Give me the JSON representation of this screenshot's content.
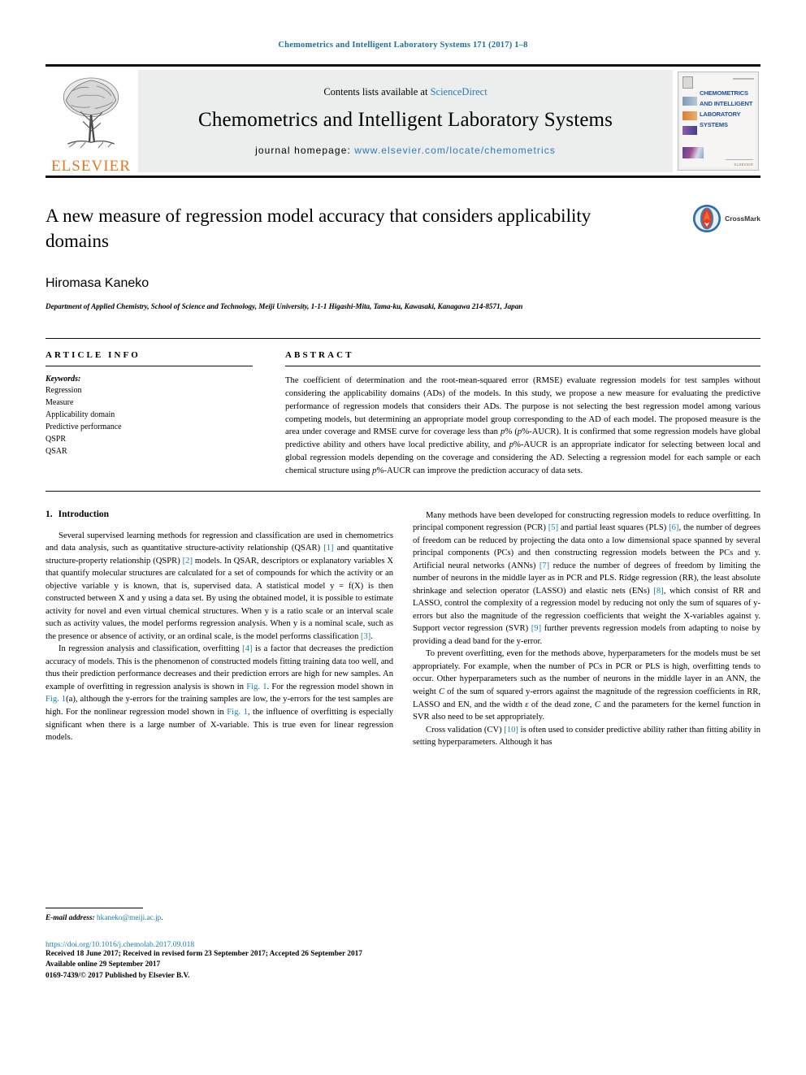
{
  "running_head": "Chemometrics and Intelligent Laboratory Systems 171 (2017) 1–8",
  "masthead": {
    "contents_prefix": "Contents lists available at ",
    "sciencedirect": "ScienceDirect",
    "journal_title": "Chemometrics and Intelligent Laboratory Systems",
    "homepage_label": "journal homepage: ",
    "homepage_url": "www.elsevier.com/locate/chemometrics",
    "publisher_wordmark": "ELSEVIER",
    "cover_lines": [
      "CHEMOMETRICS",
      "AND INTELLIGENT",
      "LABORATORY",
      "SYSTEMS"
    ],
    "cover_publisher": "ELSEVIER",
    "accent_link_color": "#2b7bb9",
    "publisher_color": "#E87722"
  },
  "article": {
    "title": "A new measure of regression model accuracy that considers applicability domains",
    "crossmark_label": "CrossMark",
    "authors": "Hiromasa Kaneko",
    "affiliation": "Department of Applied Chemistry, School of Science and Technology, Meiji University, 1-1-1 Higashi-Mita, Tama-ku, Kawasaki, Kanagawa 214-8571, Japan"
  },
  "article_info": {
    "heading": "ARTICLE INFO",
    "keywords_label": "Keywords:",
    "keywords": [
      "Regression",
      "Measure",
      "Applicability domain",
      "Predictive performance",
      "QSPR",
      "QSAR"
    ]
  },
  "abstract": {
    "heading": "ABSTRACT",
    "text": "The coefficient of determination and the root-mean-squared error (RMSE) evaluate regression models for test samples without considering the applicability domains (ADs) of the models. In this study, we propose a new measure for evaluating the predictive performance of regression models that considers their ADs. The purpose is not selecting the best regression model among various competing models, but determining an appropriate model group corresponding to the AD of each model. The proposed measure is the area under coverage and RMSE curve for coverage less than p% (p%-AUCR). It is confirmed that some regression models have global predictive ability and others have local predictive ability, and p%-AUCR is an appropriate indicator for selecting between local and global regression models depending on the coverage and considering the AD. Selecting a regression model for each sample or each chemical structure using p%-AUCR can improve the prediction accuracy of data sets."
  },
  "introduction": {
    "number": "1.",
    "title": "Introduction",
    "left_paragraphs": [
      "Several supervised learning methods for regression and classification are used in chemometrics and data analysis, such as quantitative structure-activity relationship (QSAR) [1] and quantitative structure-property relationship (QSPR) [2] models. In QSAR, descriptors or explanatory variables X that quantify molecular structures are calculated for a set of compounds for which the activity or an objective variable y is known, that is, supervised data. A statistical model y = f(X) is then constructed between X and y using a data set. By using the obtained model, it is possible to estimate activity for novel and even virtual chemical structures. When y is a ratio scale or an interval scale such as activity values, the model performs regression analysis. When y is a nominal scale, such as the presence or absence of activity, or an ordinal scale, is the model performs classification [3].",
      "In regression analysis and classification, overfitting [4] is a factor that decreases the prediction accuracy of models. This is the phenomenon of constructed models fitting training data too well, and thus their prediction performance decreases and their prediction errors are high for new samples. An example of overfitting in regression analysis is shown in Fig. 1. For the regression model shown in Fig. 1(a), although the y-errors for the training samples are low, the y-errors for the test samples are high. For the nonlinear regression model shown in Fig. 1, the influence of overfitting is especially significant when there is a large number of X-variable. This is true even for linear regression models."
    ],
    "right_paragraphs": [
      "Many methods have been developed for constructing regression models to reduce overfitting. In principal component regression (PCR) [5] and partial least squares (PLS) [6], the number of degrees of freedom can be reduced by projecting the data onto a low dimensional space spanned by several principal components (PCs) and then constructing regression models between the PCs and y. Artificial neural networks (ANNs) [7] reduce the number of degrees of freedom by limiting the number of neurons in the middle layer as in PCR and PLS. Ridge regression (RR), the least absolute shrinkage and selection operator (LASSO) and elastic nets (ENs) [8], which consist of RR and LASSO, control the complexity of a regression model by reducing not only the sum of squares of y-errors but also the magnitude of the regression coefficients that weight the X-variables against y. Support vector regression (SVR) [9] further prevents regression models from adapting to noise by providing a dead band for the y-error.",
      "To prevent overfitting, even for the methods above, hyperparameters for the models must be set appropriately. For example, when the number of PCs in PCR or PLS is high, overfitting tends to occur. Other hyperparameters such as the number of neurons in the middle layer in an ANN, the weight C of the sum of squared y-errors against the magnitude of the regression coefficients in RR, LASSO and EN, and the width ε of the dead zone, C and the parameters for the kernel function in SVR also need to be set appropriately.",
      "Cross validation (CV) [10] is often used to consider predictive ability rather than fitting ability in setting hyperparameters. Although it has"
    ]
  },
  "footer": {
    "email_label": "E-mail address:",
    "email": "hkaneko@meiji.ac.jp",
    "email_suffix": ".",
    "doi": "https://doi.org/10.1016/j.chemolab.2017.09.018",
    "history": "Received 18 June 2017; Received in revised form 23 September 2017; Accepted 26 September 2017",
    "available": "Available online 29 September 2017",
    "copyright": "0169-7439/© 2017 Published by Elsevier B.V.",
    "link_color": "#1a7fb5"
  }
}
